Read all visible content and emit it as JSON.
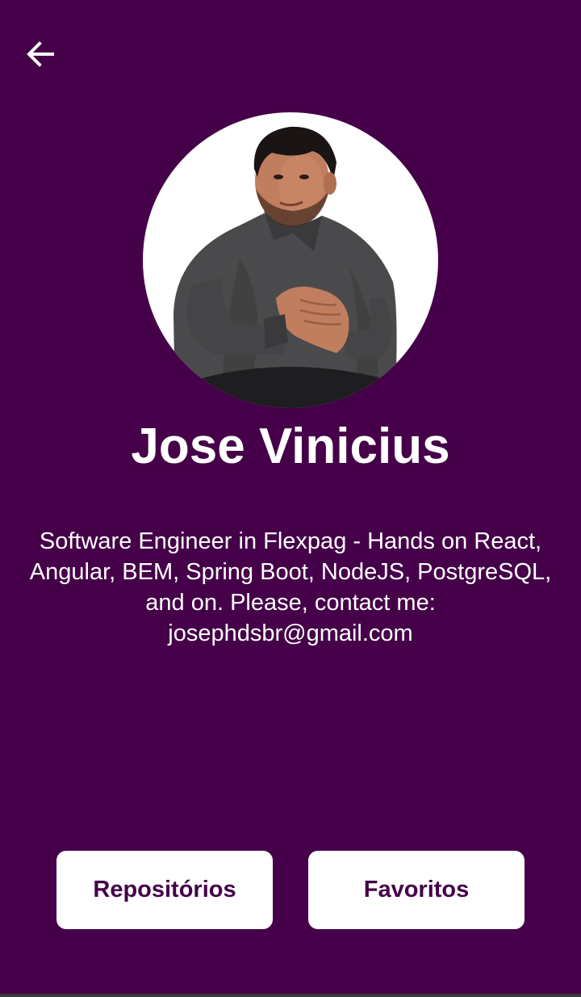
{
  "header": {
    "back_icon": "arrow-left-icon"
  },
  "profile": {
    "avatar_icon": "profile-photo",
    "name": "Jose Vinicius",
    "bio": "Software Engineer in Flexpag - Hands on React, Angular, BEM, Spring Boot, NodeJS, PostgreSQL, and on. Please, contact me: josephdsbr@gmail.com"
  },
  "actions": {
    "repositories_label": "Repositórios",
    "favorites_label": "Favoritos"
  },
  "colors": {
    "background": "#450049",
    "button_background": "#ffffff",
    "button_text": "#450049",
    "text": "#ffffff"
  }
}
